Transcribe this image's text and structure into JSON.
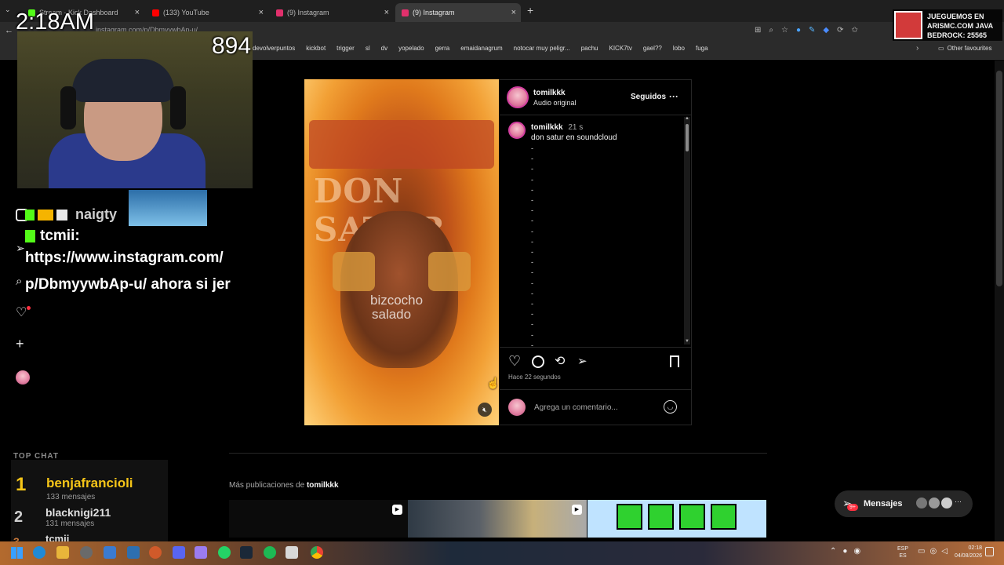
{
  "browser": {
    "tabs": [
      {
        "label": "Stream - Kick Dashboard",
        "color": "#53fc18",
        "active": false
      },
      {
        "label": "(133) YouTube",
        "color": "#ff0000",
        "active": false
      },
      {
        "label": "(9) Instagram",
        "color": "#e1306c",
        "active": false
      },
      {
        "label": "(9) Instagram",
        "color": "#e1306c",
        "active": true
      }
    ],
    "url": "instagram.com/p/DbmyywbAp-u/",
    "bookmarks": [
      "devolverpuntos",
      "kickbot",
      "trigger",
      "sl",
      "dv",
      "yopelado",
      "gerra",
      "emaidanagrum",
      "notocar muy peligr...",
      "pachu",
      "KICK7tv",
      "gael??",
      "lobo",
      "fuga"
    ],
    "other_favourites": "Other favourites"
  },
  "overlay": {
    "clock": "2:18AM",
    "counter": "894",
    "server_banner": [
      "JUEGUEMOS EN",
      "ARISMC.COM JAVA",
      "BEDROCK: 25565"
    ]
  },
  "chat": {
    "prev_user": "naigty",
    "user": "tcmii:",
    "message": [
      "https://www.instagram.com/",
      "p/DbmyywbAp-u/ ahora si jer"
    ],
    "top_chat_title": "TOP CHAT",
    "top_chat": [
      {
        "rank": "1",
        "name": "benjafrancioli",
        "count": "133 mensajes"
      },
      {
        "rank": "2",
        "name": "blacknigi211",
        "count": "131 mensajes"
      },
      {
        "rank": "3",
        "name": "tcmii",
        "count": ""
      }
    ]
  },
  "post": {
    "username": "tomilkkk",
    "audio": "Audio original",
    "following": "Seguidos",
    "more": "···",
    "caption_user": "tomilkkk",
    "caption_time": "21 s",
    "caption_text": "don satur en soundcloud",
    "dots_count": 20,
    "posted_ago": "Hace 22 segundos",
    "comment_placeholder": "Agrega un comentario...",
    "media_text_top": "DON SATUR",
    "media_text_bottom": [
      "bizcocho",
      "salado"
    ]
  },
  "more_posts": {
    "label": "Más publicaciones de",
    "user": "tomilkkk"
  },
  "messages": {
    "label": "Mensajes",
    "badge": "9+"
  },
  "system": {
    "lang": "ESP",
    "lang2": "ES",
    "time": "02:18",
    "date": "04/08/2026"
  }
}
